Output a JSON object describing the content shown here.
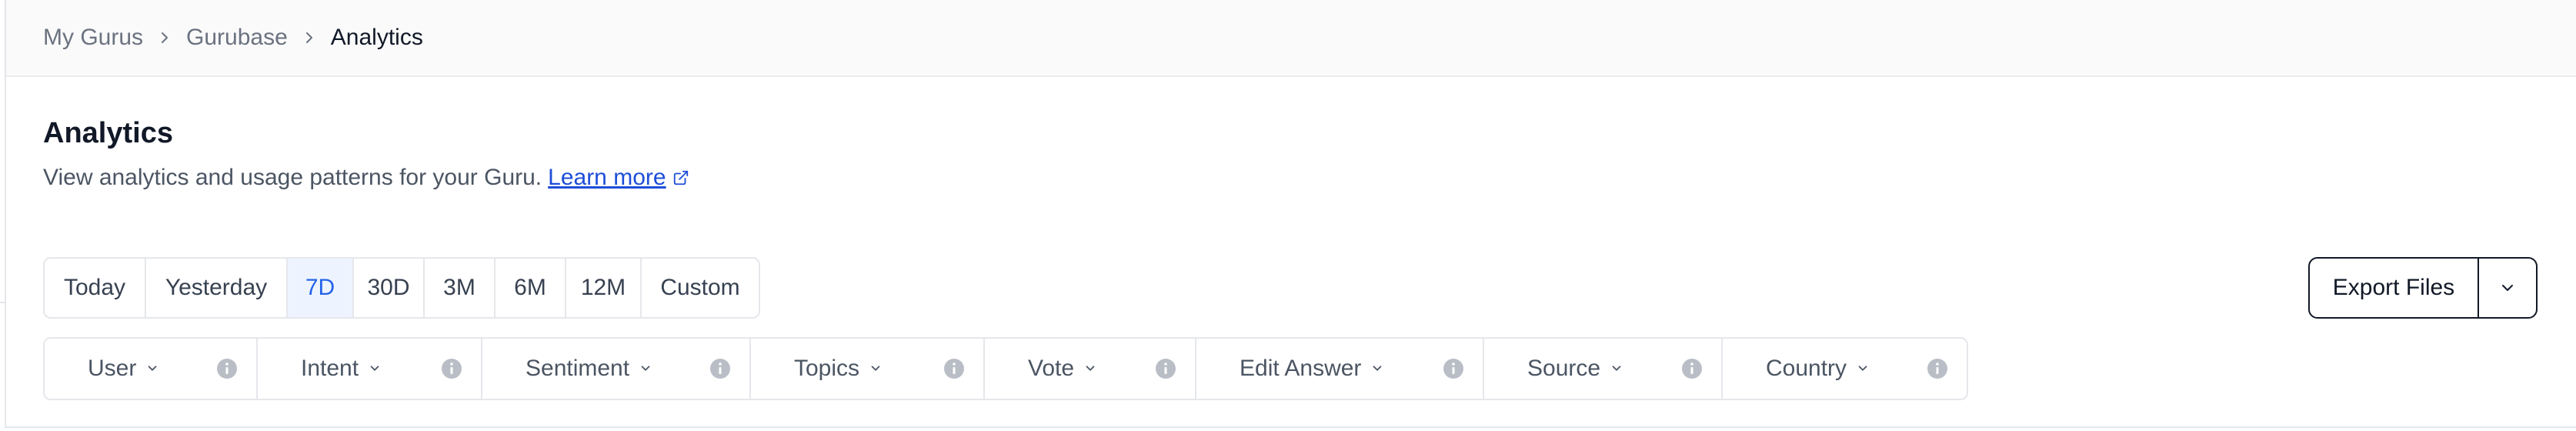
{
  "breadcrumb": {
    "items": [
      {
        "label": "My Gurus"
      },
      {
        "label": "Gurubase"
      },
      {
        "label": "Analytics"
      }
    ]
  },
  "header": {
    "title": "Analytics",
    "subtitle": "View analytics and usage patterns for your Guru.",
    "learn_more": "Learn more"
  },
  "date_ranges": {
    "selected": "7D",
    "items": [
      {
        "label": "Today"
      },
      {
        "label": "Yesterday"
      },
      {
        "label": "7D"
      },
      {
        "label": "30D"
      },
      {
        "label": "3M"
      },
      {
        "label": "6M"
      },
      {
        "label": "12M"
      },
      {
        "label": "Custom"
      }
    ]
  },
  "filters": {
    "items": [
      {
        "label": "User"
      },
      {
        "label": "Intent"
      },
      {
        "label": "Sentiment"
      },
      {
        "label": "Topics"
      },
      {
        "label": "Vote"
      },
      {
        "label": "Edit Answer"
      },
      {
        "label": "Source"
      },
      {
        "label": "Country"
      }
    ]
  },
  "export": {
    "label": "Export Files"
  },
  "colors": {
    "accent": "#2563eb",
    "active_bg": "#eef4ff",
    "link": "#1d4ed8",
    "border": "#e5e7eb"
  },
  "icons": [
    "chevron-right-icon",
    "external-link-icon",
    "chevron-down-icon",
    "info-icon"
  ]
}
